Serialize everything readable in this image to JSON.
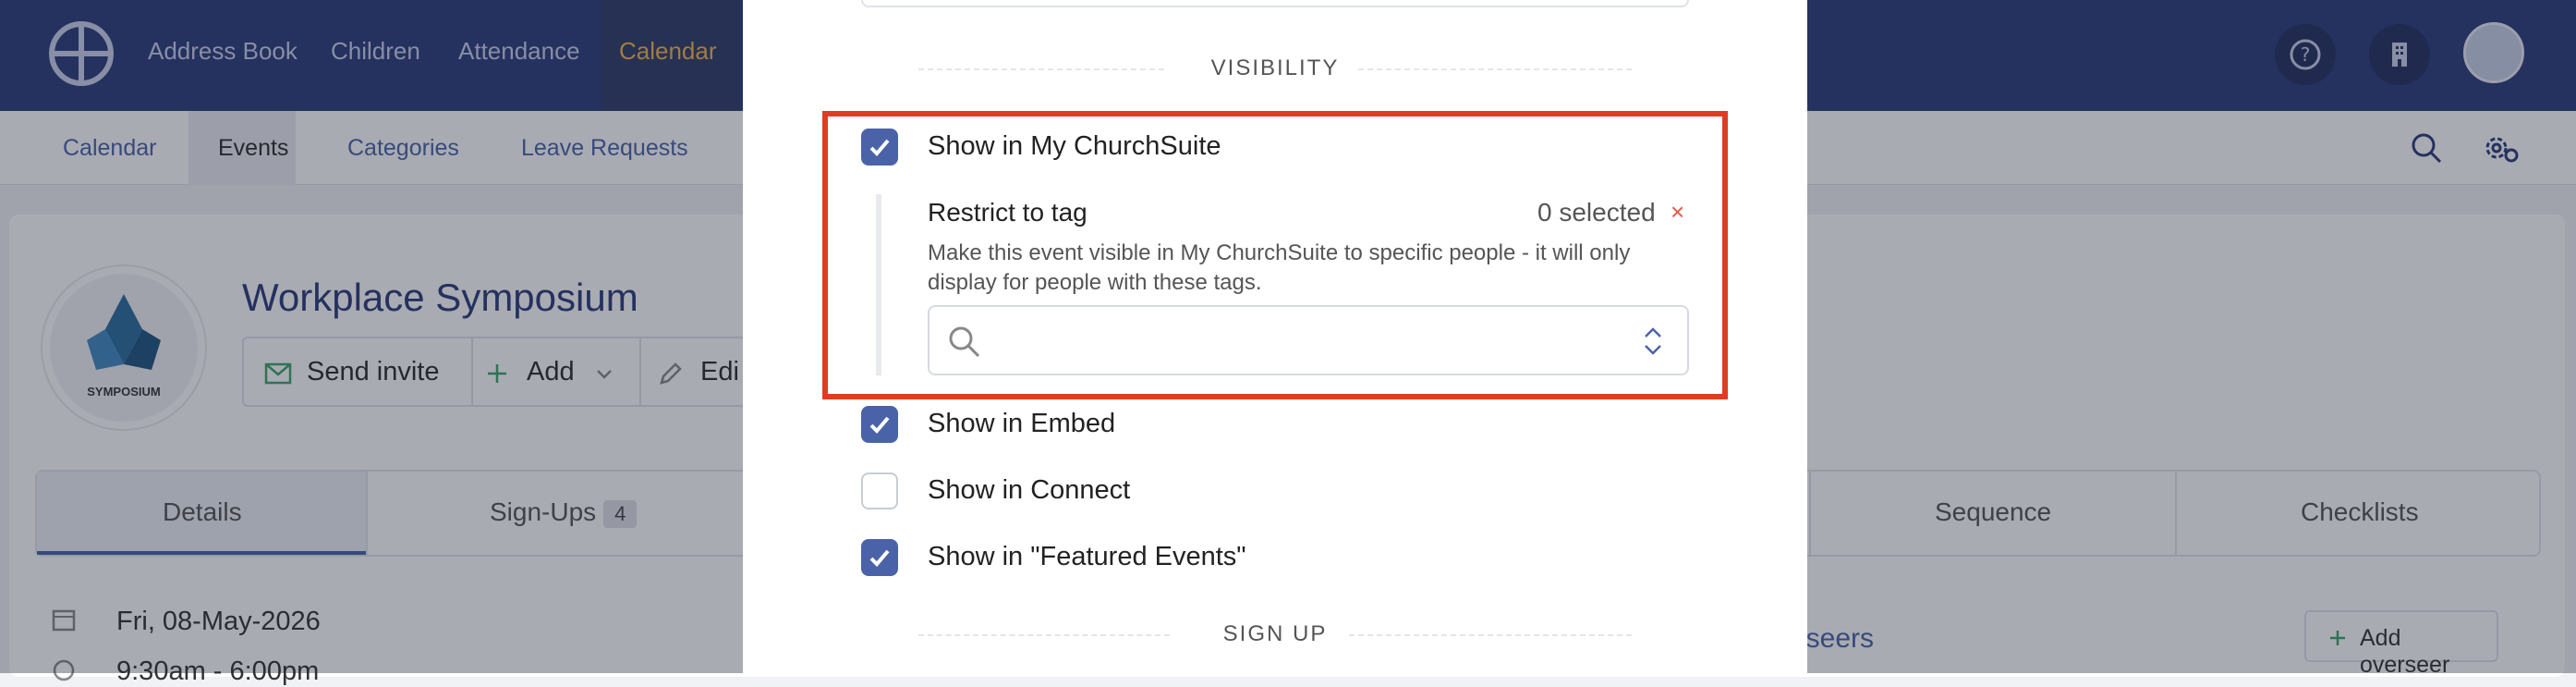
{
  "topnav": {
    "items": [
      "Address Book",
      "Children",
      "Attendance",
      "Calendar"
    ],
    "active": "Calendar"
  },
  "subnav": {
    "items": [
      "Calendar",
      "Events",
      "Categories",
      "Leave Requests"
    ],
    "active": "Events"
  },
  "event": {
    "title": "Workplace Symposium",
    "logo_text": "SYMPOSIUM",
    "actions": [
      "Send invite",
      "Add",
      "Edi"
    ],
    "date": "Fri, 08-May-2026",
    "time_partial": "9:30am - 6:00pm"
  },
  "tabs": {
    "details": "Details",
    "signups": "Sign-Ups",
    "signups_count": "4",
    "sequence": "Sequence",
    "checklists": "Checklists"
  },
  "overseers": {
    "label_partial": "erseers",
    "add_button": "Add overseer"
  },
  "modal": {
    "visibility_heading": "VISIBILITY",
    "signup_heading": "SIGN UP",
    "show_mychurchsuite": {
      "label": "Show in My ChurchSuite",
      "checked": true
    },
    "restrict": {
      "title": "Restrict to tag",
      "count": "0 selected",
      "clear": "×",
      "help": "Make this event visible in My ChurchSuite to specific people - it will only display for people with these tags."
    },
    "show_embed": {
      "label": "Show in Embed",
      "checked": true
    },
    "show_connect": {
      "label": "Show in Connect",
      "checked": false
    },
    "show_featured": {
      "label": "Show in \"Featured Events\"",
      "checked": true
    }
  },
  "colors": {
    "nav": "#2a3a7a",
    "accent": "#4a63a8",
    "active_nav": "#f0b44d",
    "highlight": "#e03c24"
  },
  "icons": [
    "app-logo-icon",
    "help-icon",
    "building-icon",
    "search-icon",
    "settings-icon",
    "envelope-icon",
    "plus-icon",
    "chevron-down-icon",
    "pencil-icon",
    "calendar-icon",
    "clock-icon",
    "checkmark-icon",
    "updown-chevron-icon"
  ]
}
